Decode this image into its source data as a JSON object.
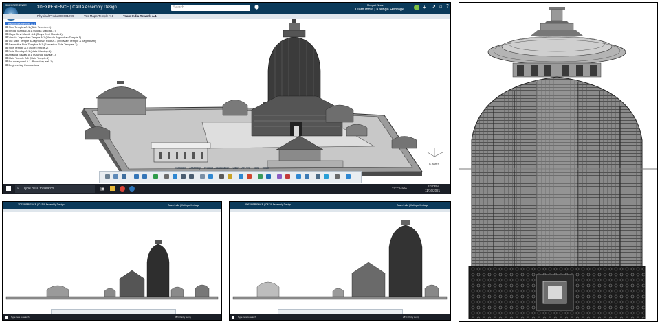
{
  "main": {
    "app_name": "3DEXPERIENCE",
    "compass_label": "3D",
    "title": "3DEXPERIENCE | CATIA  Assembly Design",
    "search_placeholder": "Search",
    "user_name": "Maquat Nuaz",
    "workspace": "Team India | Kalinga Heritage",
    "tabs": [
      "Physical Product00001299",
      "Vas Maps Temple A.1",
      "Team India Rework A.1"
    ],
    "tree_items": [
      "Team India Rework A.1",
      "Side Temples A.1 (Side Temples.1)",
      "Bhoga Mandap A.1 (Bhoga Mandap.1)",
      "Maya Devi Mandir A.1 (Maya Devi Mandir.1)",
      "Vimala Jagmohan Temple A.1 (Vimala Jagmohan Temple.1)",
      "VM Main Temple & Jagmohan Roof A.1 (VM Main Temple & Jagmohan)",
      "Samastha Side Temples A.1 (Samastha Side Temples.1)",
      "Side Temple A.2 (Side Temple.2)",
      "Nata Mandap A.1 (Nata Mandap.1)",
      "Ananda Bazaar A.1 (Ananda Bazaar.1)",
      "Main Temple A.1 (Main Temple.1)",
      "Boundary wall A.1 (Boundary wall.1)",
      "Engineering Connections"
    ],
    "scale_label": "0.000 ft",
    "taskbar": {
      "search_text": "Type here to search",
      "weather": "27°C Haze",
      "time": "8:17 PM",
      "date": "11/16/2021"
    }
  },
  "bottom_left": {
    "title": "3DEXPERIENCE | CATIA  Assembly Design",
    "workspace": "Team India | Kalinga Heritage",
    "taskbar": {
      "search_text": "Type here to search",
      "weather": "28°C Partly sunny"
    }
  },
  "bottom_right": {
    "title": "3DEXPERIENCE | CATIA  Assembly Design",
    "workspace": "Team India | Kalinga Heritage",
    "taskbar": {
      "search_text": "Type here to search",
      "weather": "28°C Partly sunny"
    }
  },
  "toolbar_tabs": [
    "Standard",
    "Assembly",
    "Product Collaboration",
    "View",
    "AR-VR",
    "Tools",
    "Touch"
  ],
  "colors": {
    "title_bar": "#0b3a5a",
    "tree_selection": "#2f6fd0",
    "taskbar": "#1b1f27",
    "model_grey": "#8a8a8a",
    "model_dark": "#2a2a2a"
  },
  "icons": [
    "compass-icon",
    "search-icon",
    "tag-icon",
    "user-avatar-icon",
    "plus-icon",
    "share-icon",
    "home-icon",
    "help-icon",
    "windows-start-icon",
    "task-view-icon",
    "folder-icon",
    "chrome-icon"
  ]
}
